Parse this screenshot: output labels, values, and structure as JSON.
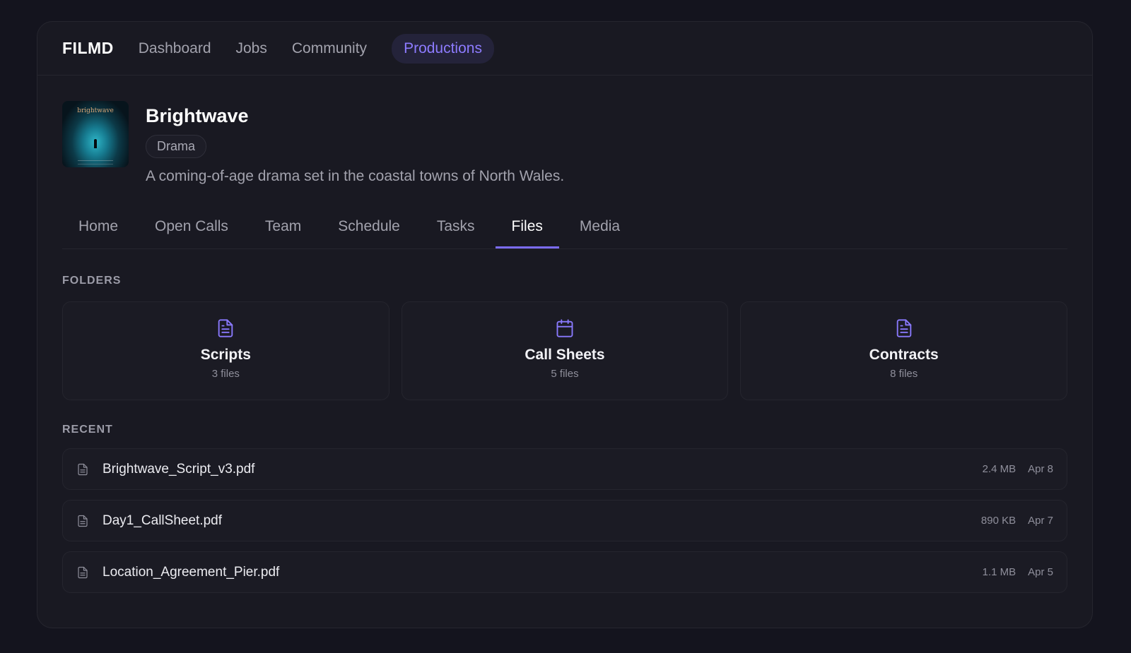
{
  "nav": {
    "brand": "FILMD",
    "links": [
      {
        "label": "Dashboard",
        "active": false
      },
      {
        "label": "Jobs",
        "active": false
      },
      {
        "label": "Community",
        "active": false
      },
      {
        "label": "Productions",
        "active": true
      }
    ]
  },
  "production": {
    "poster_text": "brightwave",
    "title": "Brightwave",
    "genre": "Drama",
    "description": "A coming-of-age drama set in the coastal towns of North Wales."
  },
  "tabs": [
    {
      "label": "Home",
      "active": false
    },
    {
      "label": "Open Calls",
      "active": false
    },
    {
      "label": "Team",
      "active": false
    },
    {
      "label": "Schedule",
      "active": false
    },
    {
      "label": "Tasks",
      "active": false
    },
    {
      "label": "Files",
      "active": true
    },
    {
      "label": "Media",
      "active": false
    }
  ],
  "folders_section": {
    "label": "FOLDERS",
    "items": [
      {
        "name": "Scripts",
        "count": "3 files",
        "icon": "document-icon"
      },
      {
        "name": "Call Sheets",
        "count": "5 files",
        "icon": "calendar-icon"
      },
      {
        "name": "Contracts",
        "count": "8 files",
        "icon": "document-icon"
      }
    ]
  },
  "recent_section": {
    "label": "RECENT",
    "files": [
      {
        "name": "Brightwave_Script_v3.pdf",
        "size": "2.4 MB",
        "date": "Apr 8",
        "icon": "file-icon"
      },
      {
        "name": "Day1_CallSheet.pdf",
        "size": "890 KB",
        "date": "Apr 7",
        "icon": "file-icon"
      },
      {
        "name": "Location_Agreement_Pier.pdf",
        "size": "1.1 MB",
        "date": "Apr 5",
        "icon": "file-icon"
      }
    ]
  },
  "colors": {
    "background": "#14141e",
    "panel": "#191922",
    "accent": "#7b6cf6",
    "active_nav_text": "#8d7bff"
  }
}
